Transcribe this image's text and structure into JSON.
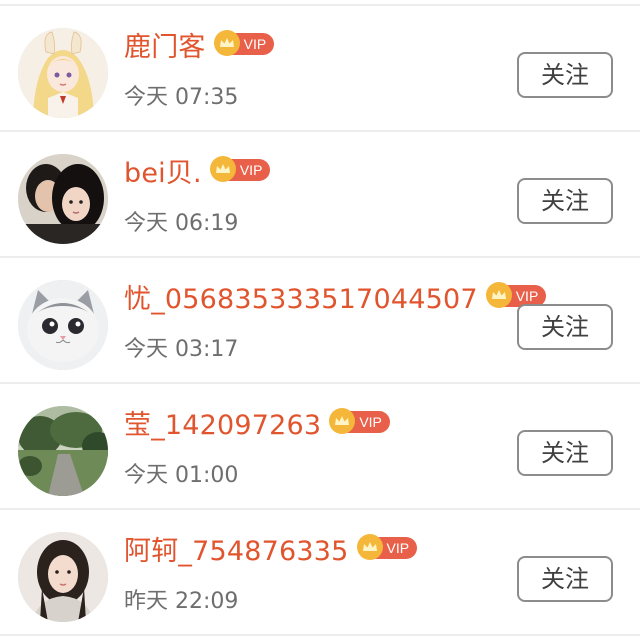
{
  "users": [
    {
      "name": "鹿门客",
      "vip_label": "VIP",
      "time": "今天 07:35",
      "follow_label": "关注",
      "avatar": "anime-girl-avatar"
    },
    {
      "name": "bei贝.",
      "vip_label": "VIP",
      "time": "今天 06:19",
      "follow_label": "关注",
      "avatar": "couple-photo-avatar"
    },
    {
      "name": "忧_056835333517044507",
      "vip_label": "VIP",
      "time": "今天 03:17",
      "follow_label": "关注",
      "avatar": "cat-avatar"
    },
    {
      "name": "莹_142097263",
      "vip_label": "VIP",
      "time": "今天 01:00",
      "follow_label": "关注",
      "avatar": "park-path-avatar"
    },
    {
      "name": "阿轲_754876335",
      "vip_label": "VIP",
      "time": "昨天 22:09",
      "follow_label": "关注",
      "avatar": "woman-portrait-avatar"
    }
  ],
  "colors": {
    "name": "#e0552e",
    "vip_badge": "#e8604a",
    "crown": "#f4b73a",
    "time": "#6e6e6e",
    "follow_border": "#8c8c8c"
  }
}
